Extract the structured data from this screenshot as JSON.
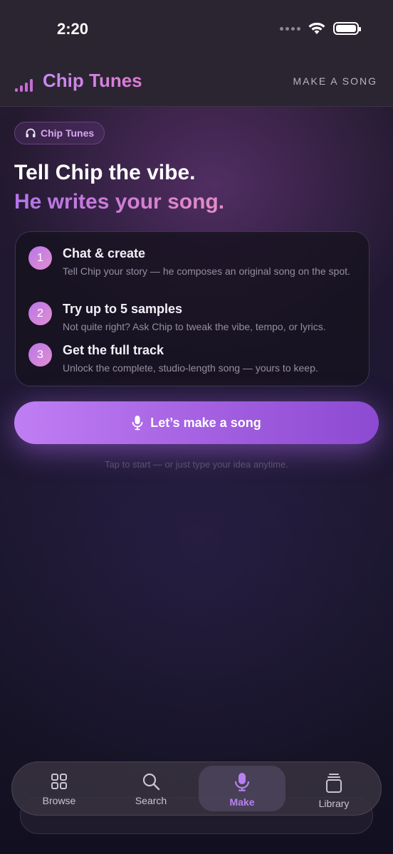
{
  "status_bar": {
    "time": "2:20"
  },
  "header": {
    "app_name": "Chip Tunes",
    "action": "MAKE A SONG"
  },
  "pill": {
    "label": "Chip Tunes"
  },
  "hero": {
    "line1": "Tell Chip the vibe.",
    "line2": "He writes your song."
  },
  "steps": [
    {
      "num": "1",
      "title": "Chat & create",
      "desc": "Tell Chip your story — he composes an original song on the spot."
    },
    {
      "num": "2",
      "title": "Try up to 5 samples",
      "desc": "Not quite right? Ask Chip to tweak the vibe, tempo, or lyrics."
    },
    {
      "num": "3",
      "title": "Get the full track",
      "desc": "Unlock the complete, studio-length song — yours to keep."
    }
  ],
  "cta": {
    "label": "Let’s make a song"
  },
  "hint": "Tap to start — or just type your idea anytime.",
  "tabs": [
    {
      "label": "Browse",
      "icon": "grid-icon"
    },
    {
      "label": "Search",
      "icon": "search-icon"
    },
    {
      "label": "Make",
      "icon": "mic-icon",
      "active": true
    },
    {
      "label": "Library",
      "icon": "stack-icon"
    }
  ],
  "colors": {
    "accent": "#b681f2",
    "gradient_pink": "#e07ad0",
    "background": "#1d1730"
  }
}
